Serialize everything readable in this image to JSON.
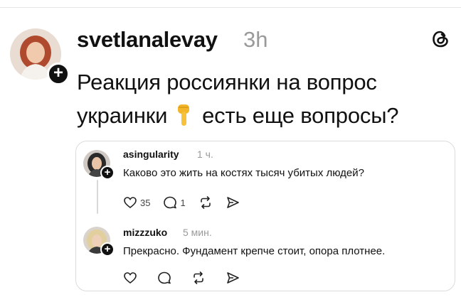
{
  "post": {
    "username": "svetlanalevay",
    "time": "3h",
    "text_line1": "Реакция россиянки на вопрос",
    "text_line2_before": "украинки",
    "text_line2_after": "есть еще вопросы?",
    "emoji_icon": "pointing-down-hand-emoji"
  },
  "quoted": {
    "reply1": {
      "username": "asingularity",
      "time": "1 ч.",
      "text": "Каково это жить на костях тысяч убитых людей?",
      "likes": "35",
      "comments": "1"
    },
    "reply2": {
      "username": "mizzzuko",
      "time": "5 мин.",
      "text": "Прекрасно. Фундамент крепче стоит, опора плотнее."
    }
  },
  "colors": {
    "text": "#111111",
    "muted": "#9a9a9a",
    "border": "#dcdcdc",
    "badge": "#111111"
  }
}
